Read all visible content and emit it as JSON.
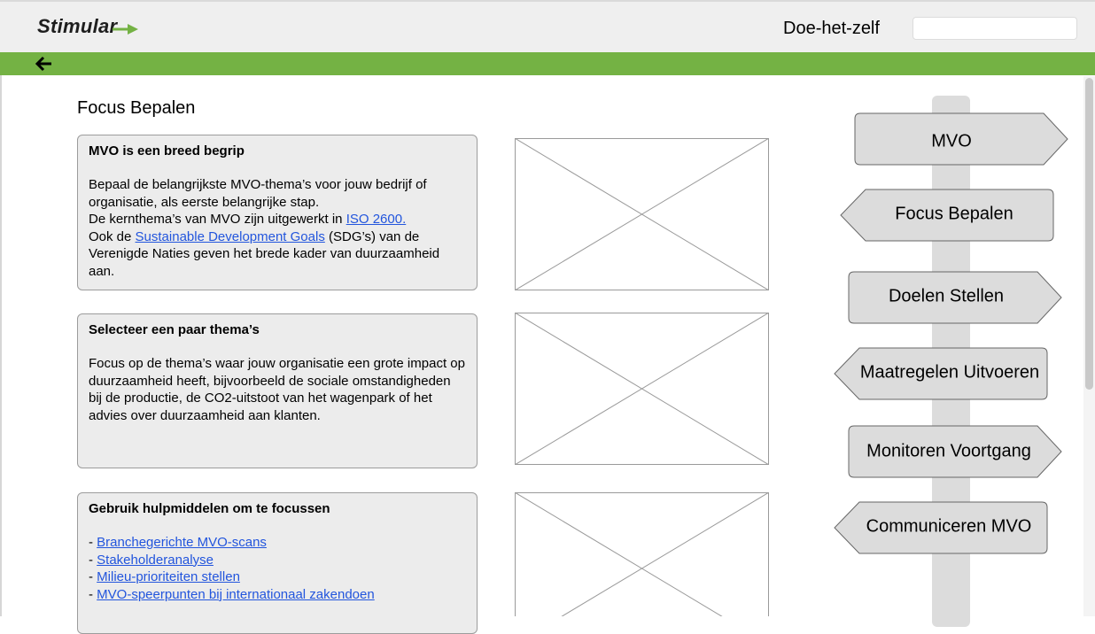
{
  "header": {
    "logo": "Stimular",
    "section": "Doe-het-zelf",
    "search": {
      "value": "",
      "placeholder": ""
    }
  },
  "nav": {
    "back_icon": "arrow-left-icon"
  },
  "page": {
    "title": "Focus Bepalen"
  },
  "cards": [
    {
      "title": "MVO is een breed begrip",
      "line1": "Bepaal de belangrijkste MVO-thema’s voor jouw bedrijf of organisatie, als eerste belangrijke stap.",
      "line2_prefix": "De kernthema’s van MVO zijn uitgewerkt in ",
      "line2_link": "ISO 2600.",
      "line3_prefix": "Ook de ",
      "line3_link": "Sustainable Development Goals",
      "line3_suffix": " (SDG’s) van de Verenigde Naties geven het brede kader van duurzaamheid aan."
    },
    {
      "title": "Selecteer een paar thema’s",
      "body": "Focus op de thema’s waar jouw organisatie een grote impact op duurzaamheid heeft, bijvoorbeeld de sociale omstandigheden bij de productie, de CO2-uitstoot van het wagenpark of het advies over duurzaamheid aan klanten."
    },
    {
      "title": "Gebruik hulpmiddelen om te focussen",
      "items": [
        {
          "bullet": "- ",
          "link": "Branchegerichte MVO-scans"
        },
        {
          "bullet": "- ",
          "link": "Stakeholderanalyse"
        },
        {
          "bullet": "- ",
          "link": "Milieu-prioriteiten stellen"
        },
        {
          "bullet": "- ",
          "link": "MVO-speerpunten bij internationaal zakendoen"
        }
      ]
    }
  ],
  "signpost": [
    {
      "label": "MVO",
      "direction": "right"
    },
    {
      "label": "Focus Bepalen",
      "direction": "left"
    },
    {
      "label": "Doelen Stellen",
      "direction": "right"
    },
    {
      "label": "Maatregelen Uitvoeren",
      "direction": "left"
    },
    {
      "label": "Monitoren Voortgang",
      "direction": "right"
    },
    {
      "label": "Communiceren MVO",
      "direction": "left"
    }
  ],
  "colors": {
    "accent_green": "#74b244",
    "link_blue": "#2255dd",
    "card_bg": "#ececec",
    "sign_bg": "#dcdcdc"
  }
}
